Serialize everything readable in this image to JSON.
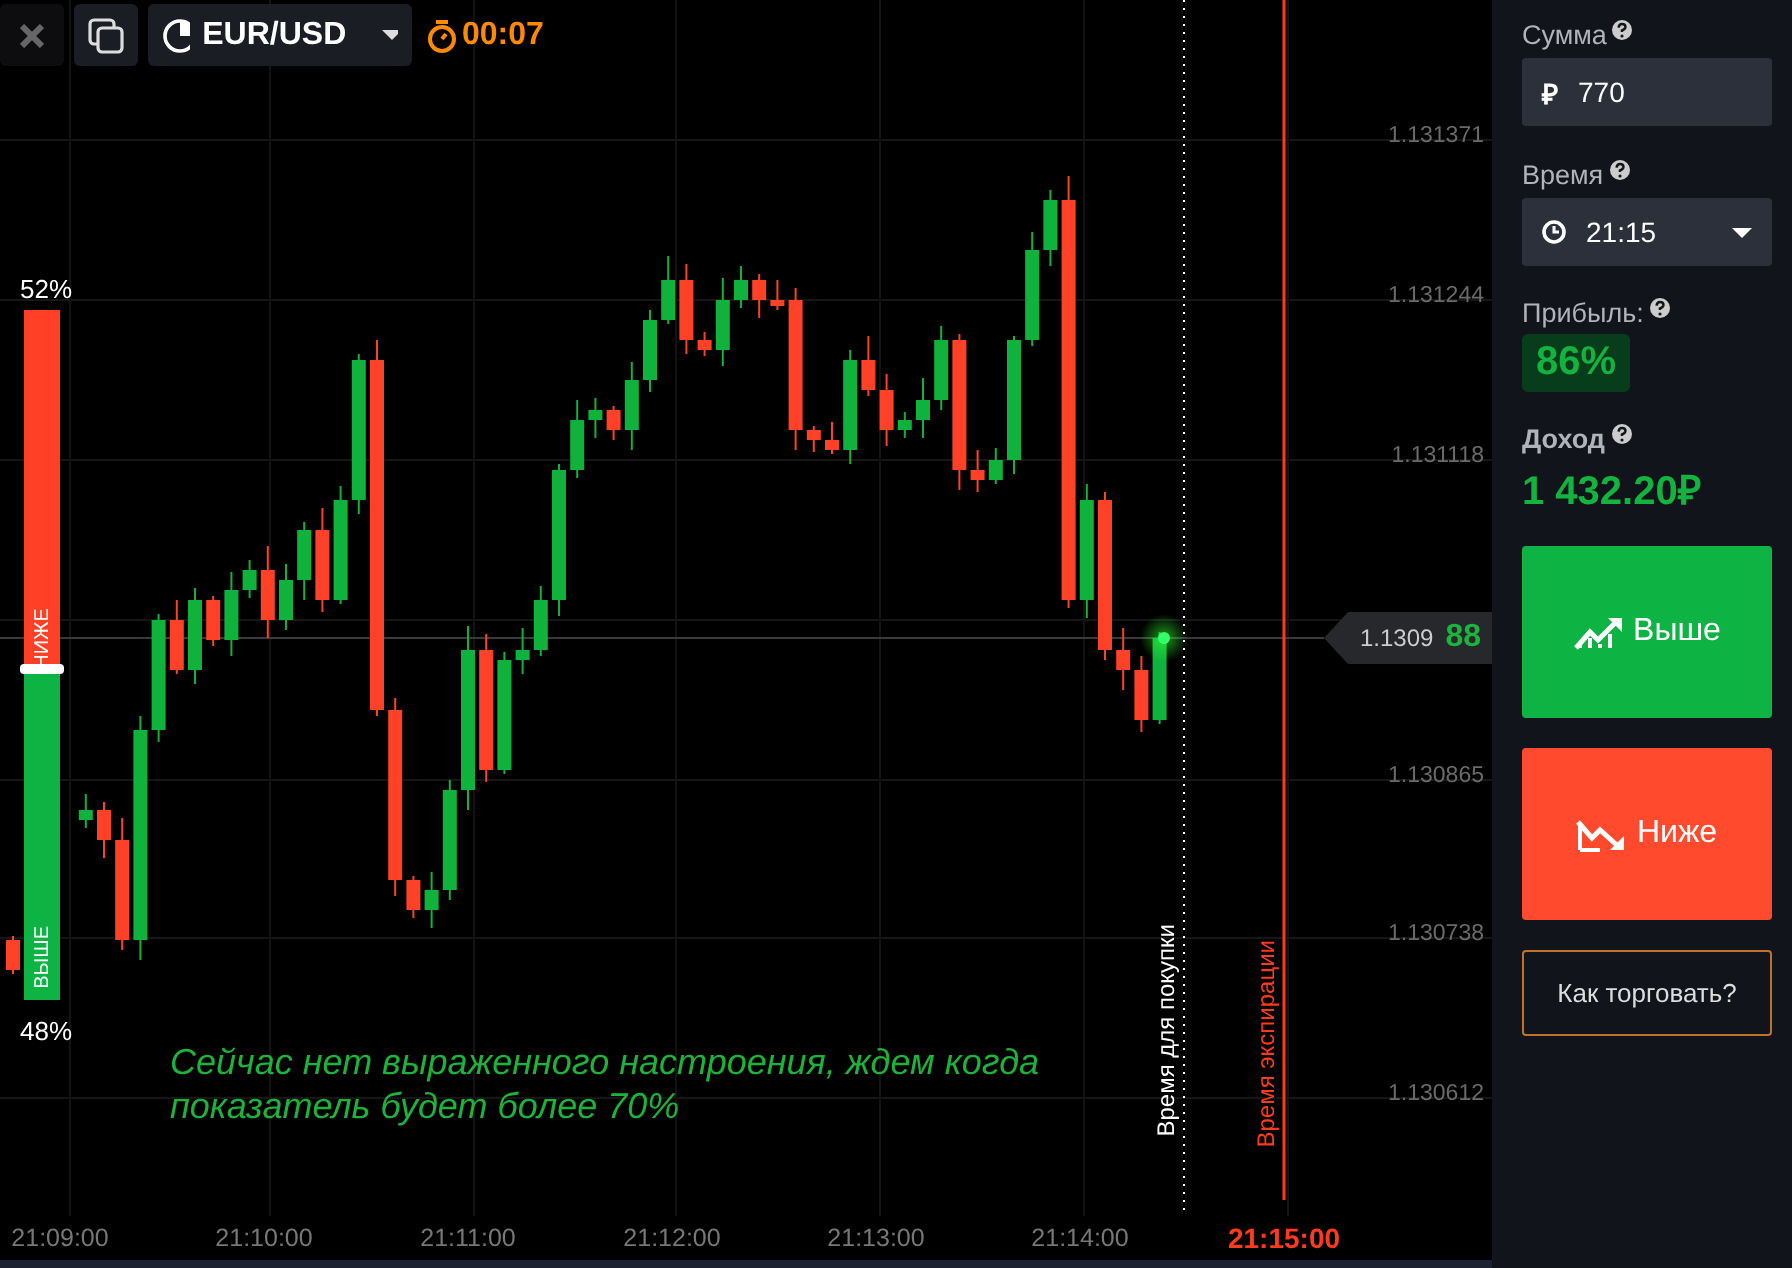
{
  "toolbar": {
    "pair": "EUR/USD",
    "timer": "00:07"
  },
  "sentiment": {
    "down_percent": "52%",
    "down_label": "НИЖЕ",
    "up_label": "ВЫШЕ",
    "up_percent": "48%",
    "level": 0.52
  },
  "chart": {
    "y_ticks": [
      "1.131371",
      "1.131244",
      "1.131118",
      "1.130865",
      "1.130738",
      "1.130612"
    ],
    "x_ticks": [
      "21:09:00",
      "21:10:00",
      "21:11:00",
      "21:12:00",
      "21:13:00",
      "21:14:00"
    ],
    "current_price": {
      "main": "1.1309",
      "last_digits": "88"
    },
    "purchase_line": {
      "label": "Время для покупки"
    },
    "expiry": {
      "label": "Время экспирации",
      "time": "21:15:00"
    },
    "message": "Сейчас нет выраженного настроения, ждем когда показатель будет более 70%"
  },
  "panel": {
    "amount": {
      "label": "Сумма",
      "currency": "₽",
      "value": "770"
    },
    "time": {
      "label": "Время",
      "value": "21:15"
    },
    "profit": {
      "label": "Прибыль:",
      "value": "86%"
    },
    "income": {
      "label": "Доход",
      "value": "1 432.20₽"
    },
    "buttons": [
      {
        "kind": "up",
        "label": "Выше"
      },
      {
        "kind": "down",
        "label": "Ниже"
      },
      {
        "kind": "help",
        "label": "Как торговать?"
      }
    ]
  }
}
